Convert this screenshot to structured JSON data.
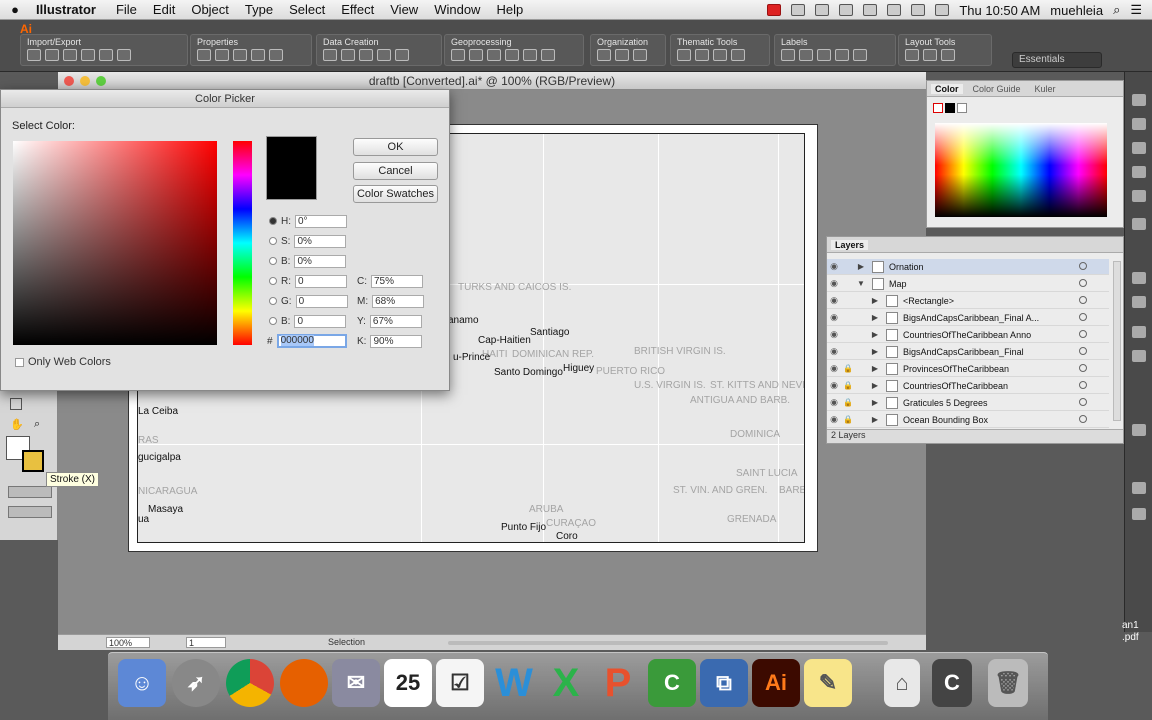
{
  "menubar": {
    "apple": "",
    "app": "Illustrator",
    "items": [
      "File",
      "Edit",
      "Object",
      "Type",
      "Select",
      "Effect",
      "View",
      "Window",
      "Help"
    ],
    "clock": "Thu 10:50 AM",
    "user": "muehleia"
  },
  "control": {
    "groups": [
      "Import/Export",
      "Properties",
      "Data Creation",
      "Geoprocessing",
      "Organization",
      "Thematic Tools",
      "Labels",
      "Layout Tools"
    ],
    "workspace": "Essentials",
    "logo": "Ai"
  },
  "document": {
    "title": "draftb [Converted].ai* @ 100% (RGB/Preview)",
    "zoom": "100%",
    "page": "1",
    "tool": "Selection"
  },
  "map": {
    "grey_labels": [
      "TURKS AND CAICOS IS.",
      "HAITI",
      "DOMINICAN REP.",
      "PUERTO RICO",
      "BRITISH VIRGIN IS.",
      "U.S. VIRGIN IS.",
      "ST. KITTS AND NEVIS",
      "ANTIGUA AND BARB.",
      "DOMINICA",
      "SAINT LUCIA",
      "ST. VIN. AND GREN.",
      "BARB",
      "GRENADA",
      "ARUBA",
      "CURAÇAO",
      "RAS",
      "NICARAGUA"
    ],
    "black_labels": [
      "anamo",
      "Santiago",
      "Cap-Haitien",
      "u-Prince",
      "Santo Domingo",
      "Higuey",
      "La Ceiba",
      "gucigalpa",
      "Masaya",
      "ua",
      "Punto Fijo",
      "Coro"
    ]
  },
  "tooltip": "Stroke (X)",
  "picker": {
    "title": "Color Picker",
    "select_label": "Select Color:",
    "ok": "OK",
    "cancel": "Cancel",
    "swatches": "Color Swatches",
    "H": "0°",
    "S": "0%",
    "B": "0%",
    "R": "0",
    "G": "0",
    "Bv": "0",
    "C": "75%",
    "M": "68%",
    "Y": "67%",
    "K": "90%",
    "hex": "000000",
    "only_web": "Only Web Colors",
    "labels": {
      "h": "H:",
      "s": "S:",
      "b": "B:",
      "r": "R:",
      "g": "G:",
      "bl": "B:",
      "c": "C:",
      "m": "M:",
      "y": "Y:",
      "k": "K:",
      "hash": "#"
    }
  },
  "color_panel": {
    "tabs": [
      "Color",
      "Color Guide",
      "Kuler"
    ]
  },
  "layers": {
    "title": "Layers",
    "rows": [
      {
        "name": "Ornation",
        "lock": false,
        "expanded": false,
        "indent": 0
      },
      {
        "name": "Map",
        "lock": false,
        "expanded": true,
        "indent": 0
      },
      {
        "name": "<Rectangle>",
        "lock": false,
        "expanded": false,
        "indent": 1
      },
      {
        "name": "BigsAndCapsCaribbean_Final A...",
        "lock": false,
        "expanded": false,
        "indent": 1
      },
      {
        "name": "CountriesOfTheCaribbean Anno",
        "lock": false,
        "expanded": false,
        "indent": 1
      },
      {
        "name": "BigsAndCapsCaribbean_Final",
        "lock": false,
        "expanded": false,
        "indent": 1
      },
      {
        "name": "ProvincesOfTheCaribbean",
        "lock": true,
        "expanded": false,
        "indent": 1
      },
      {
        "name": "CountriesOfTheCaribbean",
        "lock": true,
        "expanded": false,
        "indent": 1
      },
      {
        "name": "Graticules 5 Degrees",
        "lock": true,
        "expanded": false,
        "indent": 1
      },
      {
        "name": "Ocean Bounding Box",
        "lock": true,
        "expanded": false,
        "indent": 1
      }
    ],
    "footer": "2 Layers"
  },
  "desktop": {
    "label1": "an1",
    "label2": ".pdf"
  },
  "dock": {
    "calendar_day": "25",
    "items": [
      "Finder",
      "Launchpad",
      "Chrome",
      "Firefox",
      "Mail",
      "Calendar",
      "Reminders",
      "Word",
      "Excel",
      "PowerPoint",
      "Camtasia",
      "Parallels",
      "Illustrator",
      "Stickies",
      "Archive Utility",
      "Camtasia Recorder",
      "Trash"
    ]
  }
}
